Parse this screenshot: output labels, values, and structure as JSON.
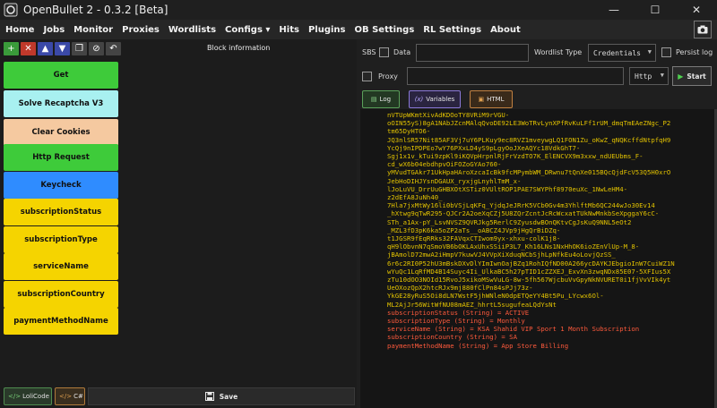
{
  "window": {
    "title": "OpenBullet 2 - 0.3.2 [Beta]",
    "minimize": "—",
    "maximize": "☐",
    "close": "✕"
  },
  "menu": [
    "Home",
    "Jobs",
    "Monitor",
    "Proxies",
    "Wordlists",
    "Configs ▾",
    "Hits",
    "Plugins",
    "OB Settings",
    "RL Settings",
    "About"
  ],
  "left": {
    "block_information": "Block information",
    "toolbar": [
      {
        "glyph": "+",
        "color": "#3a9b3a"
      },
      {
        "glyph": "✕",
        "color": "#c0392b"
      },
      {
        "glyph": "▲",
        "color": "#3b49a8"
      },
      {
        "glyph": "▼",
        "color": "#3b49a8"
      },
      {
        "glyph": "❐",
        "color": "#444444"
      },
      {
        "glyph": "⊘",
        "color": "#444444"
      },
      {
        "glyph": "↶",
        "color": "#444444"
      }
    ],
    "blocks": [
      {
        "label": "Get",
        "color": "#3ecb3a"
      },
      {
        "label": "Solve Recaptcha V3",
        "color": "#a8f0f0"
      },
      {
        "label": "Clear Cookies",
        "color": "#f5c9a0"
      },
      {
        "label": "Http Request",
        "color": "#3ecb3a"
      },
      {
        "label": "Keycheck",
        "color": "#2f8cff"
      },
      {
        "label": "subscriptionStatus",
        "color": "#f5d400"
      },
      {
        "label": "subscriptionType",
        "color": "#f5d400"
      },
      {
        "label": "serviceName",
        "color": "#f5d400"
      },
      {
        "label": "subscriptionCountry",
        "color": "#f5d400"
      },
      {
        "label": "paymentMethodName",
        "color": "#f5d400"
      }
    ],
    "bottom": {
      "lolicode": "LoliCode",
      "csharp": "C#",
      "save": "Save"
    }
  },
  "right": {
    "sbs_label": "SBS",
    "data_label": "Data",
    "data_value": "",
    "wordlist_type_label": "Wordlist Type",
    "wordlist_type_value": "Credentials",
    "persist_log_label": "Persist log",
    "proxy_label": "Proxy",
    "proxy_value": "",
    "proxy_type": "Http",
    "start": "Start",
    "tabs": {
      "log": "Log",
      "variables": "Variables",
      "html": "HTML"
    },
    "log_lines": [
      "nVTUpWKmtXivAdKDOoTY8VRiM9rVGU-",
      "oOIN55yS)8gA1NAbJZcnMAlqQvoDE92LE3WoTRvLynXPfRvKuLFf1rUM_dmqTmEAeZNgc_P2",
      "tm65DyHTO6-",
      "JQ3nlSR57Nit85AF3Vj7uY6PLKuy9ec8RVZ1mveywgLQ1FON1Zu_oKwZ_qNQKcffdNtpfqH9",
      "YcQj9nIPDPEo7wY76PXxLD4yS9pLgyOoJXeAQYc18VdkGhT7-",
      "Sgj1x1v_kTui9zpKl9iKQVpHrpnlRjFrVzdTO7K_ElENCVX9m3xxw_ndUEUbms_F-",
      "cd_wX6b04ebdhpvOiFOZoGYAo760-",
      "yMVudTGAkr71UkHpaHAroXzcaIcBk9fcMPymbWM_DRwnu7tQnXe015BQcQjdFcV53Q5H0xrO",
      "JebHoDIHJYsnDGAUX_ryxjgLnyhlTmM_x-",
      "lJoLuVU_DrrUuGHBXOtXSTiz0VUltROP1PAE7SWYPhf8970euXc_1NwLeHM4-",
      "z2dEfA8JuNh40_",
      "7Hla7jxMtWy16li0bVSjLqKFq_YjdqJeJRrK5VCb0Gv4m3YhlftMb6QC244wJo30Ev14",
      "_hXtwg9qTwR295-QJCr2A2oeXqCZj5U8ZQrZcntJcRcWcxatTUkNwMnkbSeXpggaY6cC-",
      "STh_a1Ax-pY_LsvNVSZ9QVRJkg5RerlC9ZyusdwBOnQKtvCgJsKuQ9NNL5eOt2",
      "_MZL3fD3pK6ka5oZP2aTs__oABCZ4JVp9jHgQrBiDZq-",
      "t1JGSR9fEqRRks32FAVqxCTIwom9yx-xhxu-colK1j8-",
      "qH9lObvnN7qSmoVB6bOKLAxUhxSSiiP3L7_Kh16LNs1NxHhOK6ioZEnVlUp-M_8-",
      "jBAmolD72mwA2iHmpV7kuwVJ4VVpXiXduqNCbSjhLpNfkEu4oLovjQzSS_",
      "6r6c2RI0P52hU3mBskDXvDlYImIwnOajBZq1RohIQfND00A266ycDAYKJEbgioInW7CuiWZ1N",
      "wYuQc1LqRfMD4B14Suyc4Ii_UlkaBC5h27pTID1cZZXEJ_ExvXn3zwqNDx85E07-5XFIus5X",
      "zTu10dOO3NOId15RvoJ5xikoMSwVuLG-8w-5fh567WjcbuVvGpyNkNVURET0i1fjVvVIk4yt",
      "UeOXozQpX2htcRJx9mj880fClPn84sPJj73z-",
      "YkGE28yRuS5Oi8dLN7WstF5jhWNleN0dpETQeYY4Bt5Pu_LYcwx6Ol-",
      "ML2AjJr56WitWfNU08mAEZ_hhrtL5sugufeaLQdYsNt"
    ],
    "var_lines": [
      "subscriptionStatus (String) = ACTIVE",
      "subscriptionType (String) = Monthly",
      "serviceName (String) = KSA Shahid VIP Sport 1 Month Subscription",
      "subscriptionCountry (String) = SA",
      "paymentMethodName (String) = App Store Billing"
    ]
  }
}
